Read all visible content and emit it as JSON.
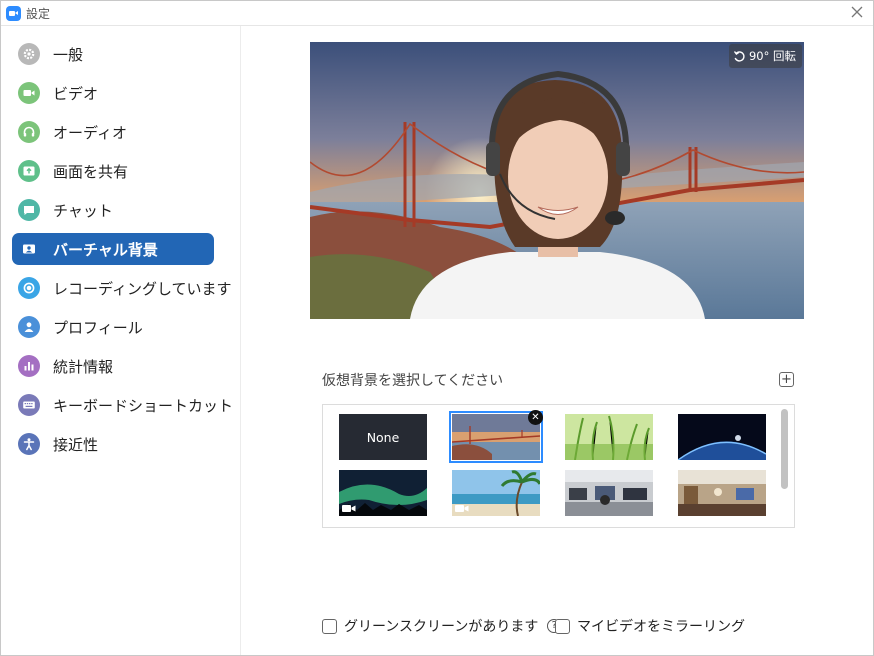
{
  "window": {
    "title": "設定"
  },
  "sidebar": {
    "items": [
      {
        "label": "一般",
        "icon": "gear-icon",
        "color": "#b0b0b0"
      },
      {
        "label": "ビデオ",
        "icon": "video-camera-icon",
        "color": "#7cc47a"
      },
      {
        "label": "オーディオ",
        "icon": "headphones-icon",
        "color": "#7cc47a"
      },
      {
        "label": "画面を共有",
        "icon": "share-screen-icon",
        "color": "#5fc08a"
      },
      {
        "label": "チャット",
        "icon": "chat-icon",
        "color": "#4fb7a6"
      },
      {
        "label": "バーチャル背景",
        "icon": "virtual-background-icon",
        "color": "#2266b5",
        "active": true
      },
      {
        "label": "レコーディングしています",
        "icon": "record-icon",
        "color": "#3aa5e6"
      },
      {
        "label": "プロフィール",
        "icon": "profile-icon",
        "color": "#4a90d9"
      },
      {
        "label": "統計情報",
        "icon": "statistics-icon",
        "color": "#a46fc2"
      },
      {
        "label": "キーボードショートカット",
        "icon": "keyboard-icon",
        "color": "#7a7ab8"
      },
      {
        "label": "接近性",
        "icon": "accessibility-icon",
        "color": "#5a74b8"
      }
    ]
  },
  "preview": {
    "rotate_label": "90° 回転"
  },
  "backgrounds": {
    "section_label": "仮想背景を選択してください",
    "none_label": "None",
    "items": [
      {
        "name": "none"
      },
      {
        "name": "golden-gate-bridge",
        "selected": true
      },
      {
        "name": "green-grass"
      },
      {
        "name": "earth-from-space"
      },
      {
        "name": "aurora",
        "video": true
      },
      {
        "name": "beach-palm",
        "video": true
      },
      {
        "name": "office-room"
      },
      {
        "name": "cafe-interior"
      }
    ]
  },
  "options": {
    "green_screen_label": "グリーンスクリーンがあります",
    "mirror_label": "マイビデオをミラーリング"
  },
  "colors": {
    "accent": "#2266b5",
    "selection": "#2d8cff"
  }
}
